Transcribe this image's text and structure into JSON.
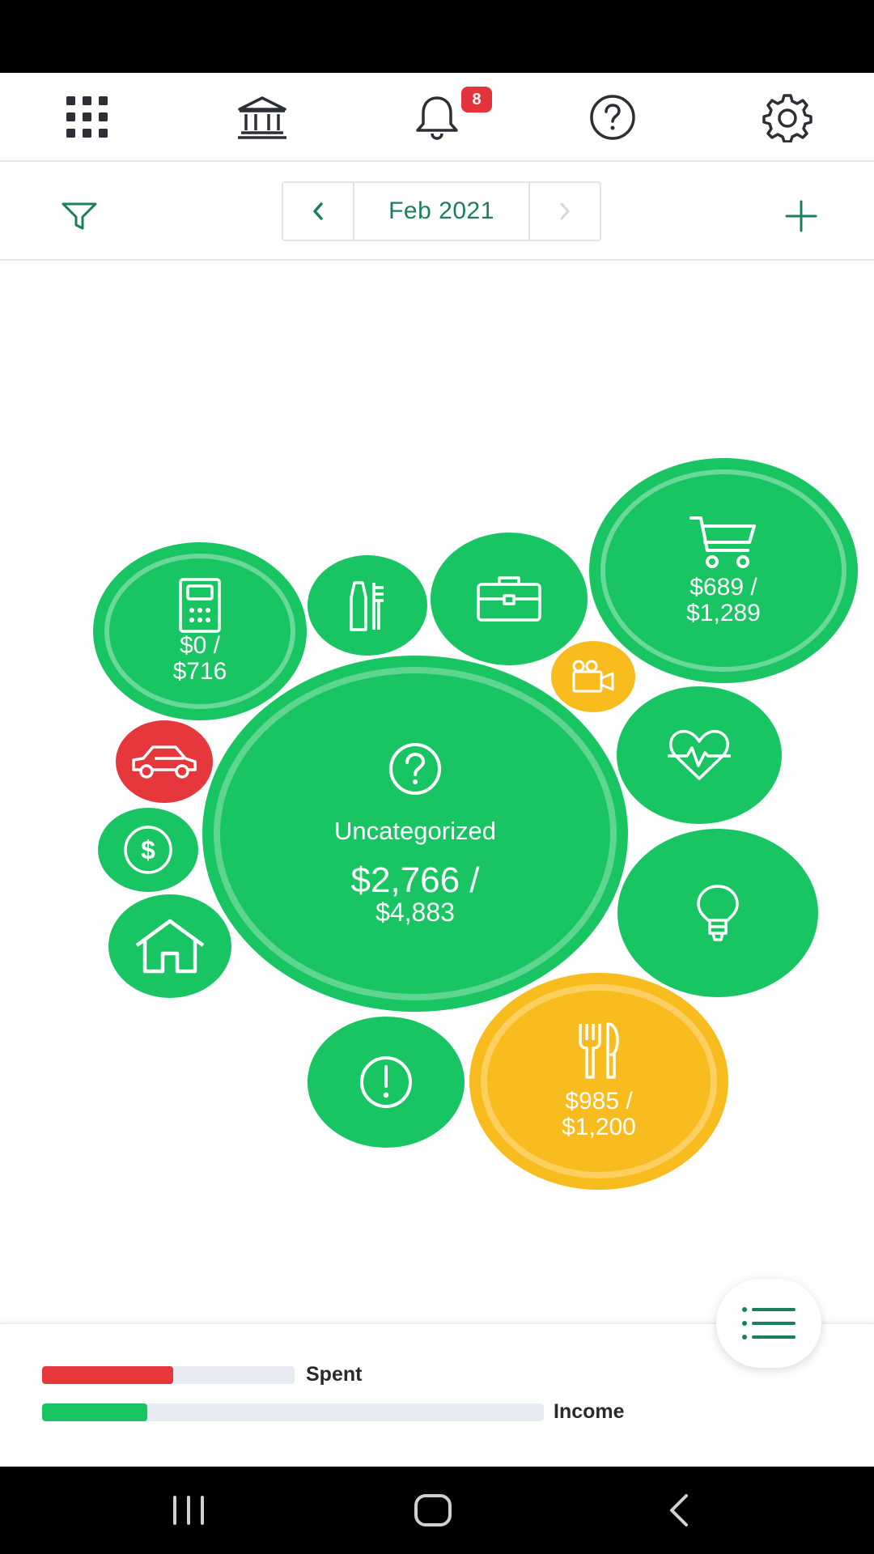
{
  "top_nav": {
    "notification_count": "8",
    "icons": [
      "grid-icon",
      "bank-icon",
      "bell-icon",
      "help-icon",
      "gear-icon"
    ]
  },
  "date_bar": {
    "month_label": "Feb 2021"
  },
  "bubbles": {
    "uncategorized": {
      "name": "Uncategorized",
      "spent": "$2,766 /",
      "budget": "$4,883"
    },
    "groceries": {
      "spent": "$689 /",
      "budget": "$1,289"
    },
    "bills": {
      "spent": "$0 /",
      "budget": "$716"
    },
    "dining": {
      "spent": "$985 /",
      "budget": "$1,200"
    }
  },
  "summary": {
    "spent_label": "Spent",
    "income_label": "Income",
    "spent_ratio": 0.52,
    "income_ratio": 0.21
  },
  "colors": {
    "green": "#19c463",
    "yellow": "#f9bc1e",
    "red": "#e6373d",
    "brand_dark_green": "#1b7f5c"
  }
}
